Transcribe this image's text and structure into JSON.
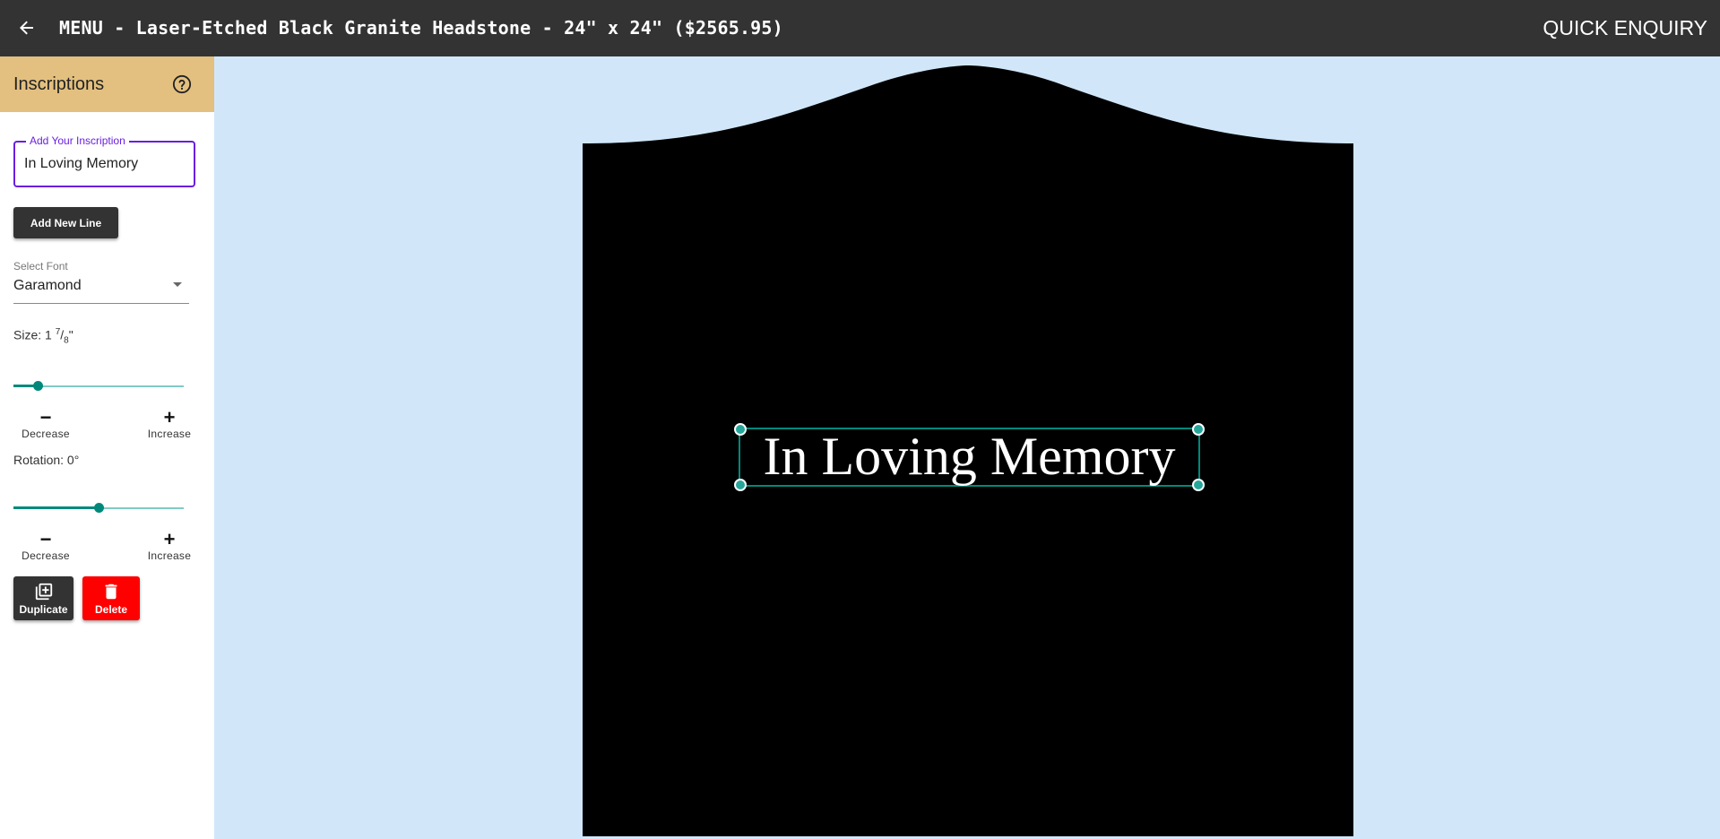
{
  "header": {
    "title": "MENU - Laser-Etched Black Granite Headstone - 24\" x 24\" ($2565.95)",
    "quick_enquiry": "QUICK ENQUIRY",
    "back_icon": "arrow-left-icon"
  },
  "panel": {
    "title": "Inscriptions",
    "help_icon": "help-circle-icon",
    "header_color": "#e3c07f",
    "inscription_input": {
      "label": "Add Your Inscription",
      "value": "In Loving Memory"
    },
    "add_line_label": "Add New Line",
    "font": {
      "label": "Select Font",
      "value": "Garamond"
    },
    "size": {
      "prefix": "Size: 1 ",
      "numerator": "7",
      "slash": "/",
      "denominator": "8",
      "suffix": "\"",
      "slider_fraction": 0.14
    },
    "rotation": {
      "label": "Rotation: 0°",
      "slider_fraction": 0.5
    },
    "decrease_label": "Decrease",
    "increase_label": "Increase",
    "decrease_symbol": "−",
    "increase_symbol": "+",
    "duplicate_label": "Duplicate",
    "delete_label": "Delete",
    "delete_color": "#ff0000",
    "accent_color": "#00897b"
  },
  "canvas": {
    "background": "#d1e7f9",
    "headstone_color": "#000000",
    "inscription_text": "In Loving Memory"
  }
}
